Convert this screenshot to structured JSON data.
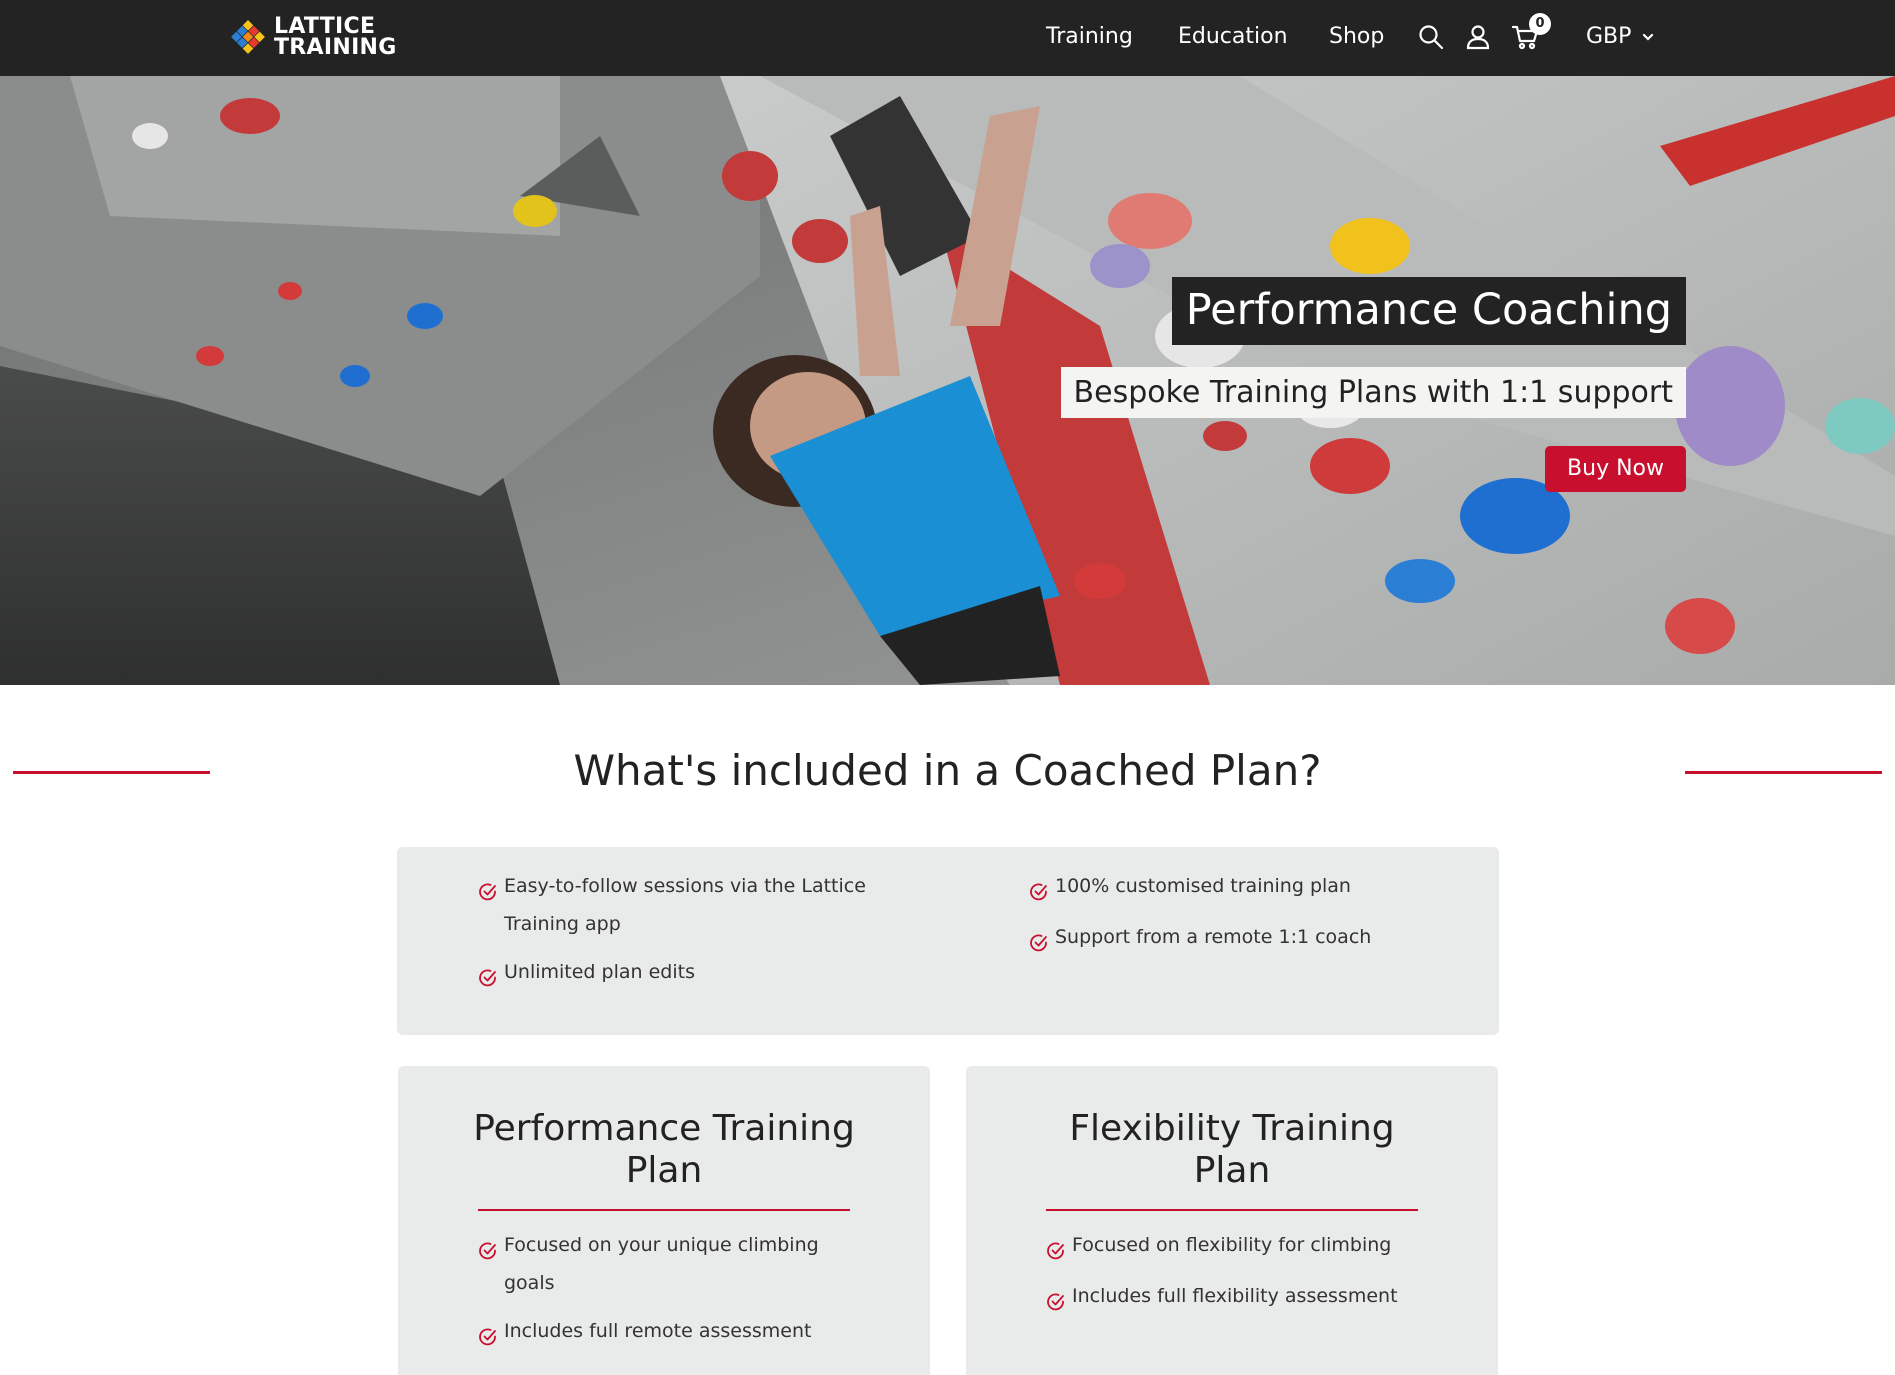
{
  "header": {
    "logo_line1": "LATTICE",
    "logo_line2": "TRAINING",
    "nav": [
      "Training",
      "Education",
      "Shop"
    ],
    "cart_count": "0",
    "currency": "GBP"
  },
  "hero": {
    "title": "Performance Coaching",
    "subtitle": "Bespoke Training Plans with 1:1 support",
    "cta": "Buy Now"
  },
  "included": {
    "heading": "What's included in a Coached Plan?",
    "left": [
      {
        "line1": "Easy-to-follow sessions via the Lattice",
        "line2": "Training app"
      },
      {
        "line1": "Unlimited plan edits"
      }
    ],
    "right": [
      {
        "line1": "100% customised training plan"
      },
      {
        "line1": "Support from a remote 1:1 coach"
      }
    ]
  },
  "plans": [
    {
      "title_line1": "Performance Training",
      "title_line2": "Plan",
      "features": [
        {
          "line1": "Focused on your unique climbing",
          "line2": "goals"
        },
        {
          "line1": "Includes full remote assessment"
        }
      ]
    },
    {
      "title_line1": "Flexibility Training",
      "title_line2": "Plan",
      "features": [
        {
          "line1": "Focused on flexibility for climbing"
        },
        {
          "line1": "Includes full flexibility assessment"
        }
      ]
    }
  ],
  "colors": {
    "header_bg": "#222322",
    "accent_red": "#c8102e",
    "panel_bg": "#e9eaea",
    "climber_shirt": "#1b8fd3"
  },
  "icons": [
    "logo-diamond-icon",
    "search-icon",
    "user-icon",
    "cart-icon",
    "chevron-down-icon",
    "check-circle-icon"
  ]
}
